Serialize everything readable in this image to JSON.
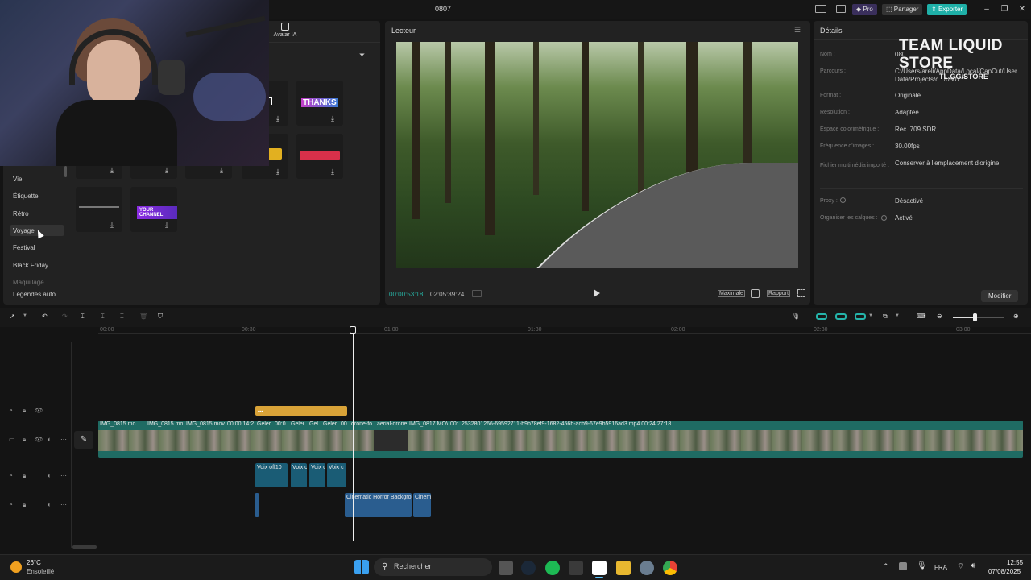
{
  "window": {
    "title": "0807",
    "pro_label": "Pro",
    "share_label": "Partager",
    "export_label": "Exporter"
  },
  "left_panel": {
    "tab_label": "Avatar IA",
    "sticker_texts": [
      "THANKS",
      "YOUR CHANNEL"
    ],
    "categories": [
      "Vie",
      "Étiquette",
      "Rétro",
      "Voyage",
      "Festival",
      "Black Friday",
      "Maquillage",
      "Légendes auto..."
    ]
  },
  "player": {
    "title": "Lecteur",
    "current_time": "00:00:53:18",
    "total_time": "02:05:39:24",
    "maximale_label": "Maximale",
    "rapport_label": "Rapport"
  },
  "details": {
    "title": "Détails",
    "rows": [
      {
        "label": "Nom :",
        "value": "080"
      },
      {
        "label": "Parcours :",
        "value": "C:/Users/areli/AppData/Local/CapCut/User Data/Projects/c.../0807"
      },
      {
        "label": "Format :",
        "value": "Originale"
      },
      {
        "label": "Résolution :",
        "value": "Adaptée"
      },
      {
        "label": "Espace colorimétrique :",
        "value": "Rec. 709 SDR"
      },
      {
        "label": "Fréquence d'images :",
        "value": "30.00fps"
      },
      {
        "label": "Fichier multimédia importé :",
        "value": "Conserver à l'emplacement d'origine"
      },
      {
        "label": "Proxy :",
        "value": "Désactivé"
      },
      {
        "label": "Organiser les calques :",
        "value": "Activé"
      }
    ],
    "modify_label": "Modifier"
  },
  "overlay": {
    "brand": "TEAM LIQUID STORE",
    "url": "TL.GG/STORE"
  },
  "timeline": {
    "ruler": [
      "00:00",
      "00:30",
      "01:00",
      "01:30",
      "02:00",
      "02:30",
      "03:00"
    ],
    "video_clips": [
      "IMG_0815.mo",
      "IMG_0815.mo",
      "IMG_0815.mov",
      "00:00:14:2",
      "Geler",
      "00:0",
      "Geler",
      "Gel",
      "Geler",
      "00",
      "drone-fo",
      "aerial-drone",
      "IMG_0817.MOV",
      "00:",
      "2532801266-69592711-b9b78ef9-1682-456b-acb9-67e9b5916ad3.mp4  00:24:27:18"
    ],
    "voice_clips": [
      "Voix off10",
      "Voix c",
      "Voix c",
      "Voix c"
    ],
    "music_clips": [
      "Cinematic Horror Backgrou",
      "Cinem"
    ]
  },
  "taskbar": {
    "weather_temp": "26°C",
    "weather_desc": "Ensoleillé",
    "search_placeholder": "Rechercher",
    "lang": "FRA",
    "time": "12:55",
    "date": "07/08/2025"
  }
}
